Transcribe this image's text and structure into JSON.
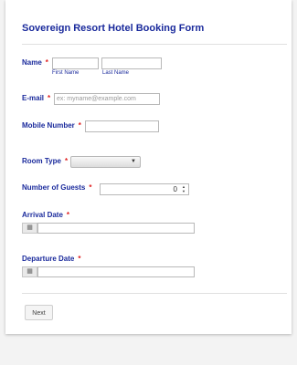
{
  "form": {
    "title": "Sovereign Resort Hotel Booking Form",
    "name": {
      "label": "Name",
      "required": "*",
      "first_sublabel": "First Name",
      "last_sublabel": "Last Name",
      "first_value": "",
      "last_value": ""
    },
    "email": {
      "label": "E-mail",
      "required": "*",
      "placeholder": "ex: myname@example.com",
      "value": ""
    },
    "mobile": {
      "label": "Mobile Number",
      "required": "*",
      "value": ""
    },
    "room_type": {
      "label": "Room Type",
      "required": "*",
      "selected": ""
    },
    "guests": {
      "label": "Number of Guests",
      "required": "*",
      "value": "0"
    },
    "arrival": {
      "label": "Arrival Date",
      "required": "*",
      "value": ""
    },
    "departure": {
      "label": "Departure Date",
      "required": "*",
      "value": ""
    },
    "next_label": "Next"
  },
  "icons": {
    "calendar": "calendar-icon",
    "dropdown": "chevron-down-icon",
    "spinner": "spinner-arrows-icon"
  },
  "colors": {
    "label": "#1a2a9c",
    "required": "#e02020",
    "background": "#f3f3f3",
    "card": "#ffffff"
  }
}
